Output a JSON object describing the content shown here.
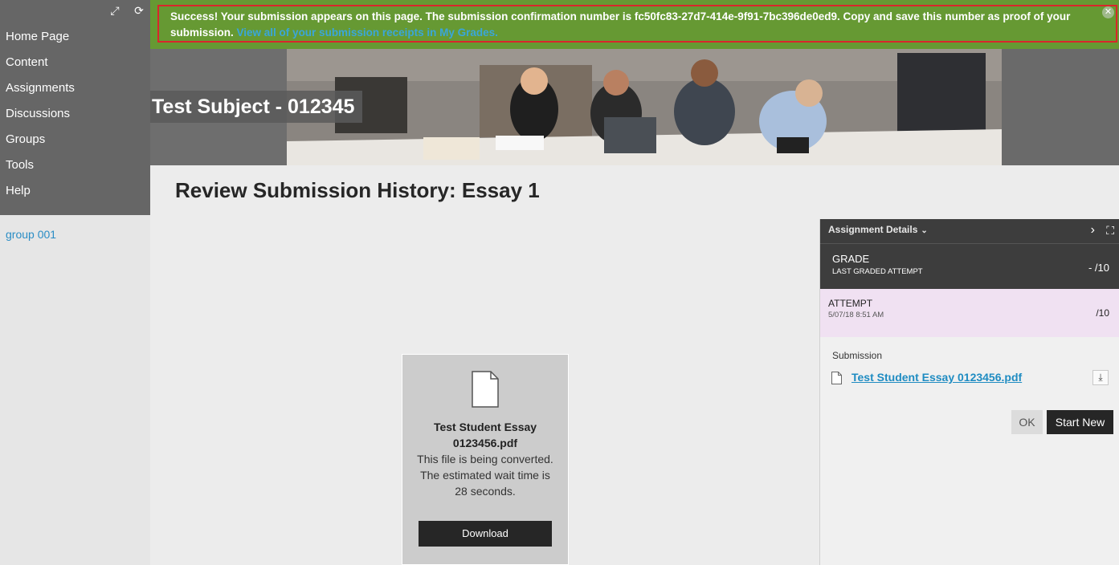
{
  "sidebar": {
    "expand_icon": "expand-icon",
    "refresh_icon": "refresh-icon",
    "items": [
      {
        "label": "Home Page"
      },
      {
        "label": "Content"
      },
      {
        "label": "Assignments"
      },
      {
        "label": "Discussions"
      },
      {
        "label": "Groups"
      },
      {
        "label": "Tools"
      },
      {
        "label": "Help"
      }
    ],
    "group_link": "group 001"
  },
  "banner": {
    "message": "Success! Your submission appears on this page. The submission confirmation number is fc50fc83-27d7-414e-9f91-7bc396de0ed9. Copy and save this number as proof of your submission.",
    "link_text": "View all of your submission receipts in My Grades.",
    "close_symbol": "✕",
    "background_color": "#669933",
    "border_color": "#d9262b"
  },
  "header": {
    "course_title": "Test Subject - 012345"
  },
  "page": {
    "title": "Review Submission History: Essay 1"
  },
  "viewer": {
    "file_name": "Test Student Essay 0123456.pdf",
    "status_message": "This file is being converted. The estimated wait time is 28 seconds.",
    "download_label": "Download"
  },
  "panel": {
    "details_label": "Assignment Details",
    "grade_title": "GRADE",
    "grade_subtitle": "LAST GRADED ATTEMPT",
    "grade_score": "- /10",
    "attempt_title": "ATTEMPT",
    "attempt_date": "5/07/18 8:51 AM",
    "attempt_score": "/10",
    "submission_label": "Submission",
    "submission_file": "Test Student Essay 0123456.pdf",
    "ok_label": "OK",
    "start_new_label": "Start New",
    "attempt_color": "#f0e1f2"
  }
}
